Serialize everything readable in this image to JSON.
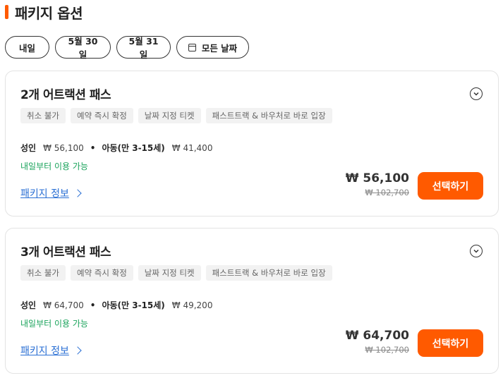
{
  "section": {
    "title": "패키지 옵션",
    "accent_color": "#ff5a00"
  },
  "date_chips": [
    {
      "label": "내일"
    },
    {
      "label": "5월 30일"
    },
    {
      "label": "5월 31일"
    },
    {
      "label": "모든 날짜",
      "icon": "calendar-icon"
    }
  ],
  "packages": [
    {
      "title": "2개 어트랙션 패스",
      "tags": [
        "취소 불가",
        "예약 즉시 확정",
        "날짜 지정 티켓",
        "패스트트랙 & 바우처로 바로 입장"
      ],
      "adult_label": "성인",
      "adult_price": "₩ 56,100",
      "separator": "•",
      "child_label": "아동(만 3-15세)",
      "child_price": "₩ 41,400",
      "availability": "내일부터 이용 가능",
      "info_link": "패키지 정보",
      "price": "₩ 56,100",
      "original_price": "₩ 102,700",
      "select_label": "선택하기"
    },
    {
      "title": "3개 어트랙션 패스",
      "tags": [
        "취소 불가",
        "예약 즉시 확정",
        "날짜 지정 티켓",
        "패스트트랙 & 바우처로 바로 입장"
      ],
      "adult_label": "성인",
      "adult_price": "₩ 64,700",
      "separator": "•",
      "child_label": "아동(만 3-15세)",
      "child_price": "₩ 49,200",
      "availability": "내일부터 이용 가능",
      "info_link": "패키지 정보",
      "price": "₩ 64,700",
      "original_price": "₩ 102,700",
      "select_label": "선택하기"
    }
  ],
  "colors": {
    "accent": "#ff5a00",
    "availability": "#1aa35b",
    "link": "#2a6fd4"
  }
}
